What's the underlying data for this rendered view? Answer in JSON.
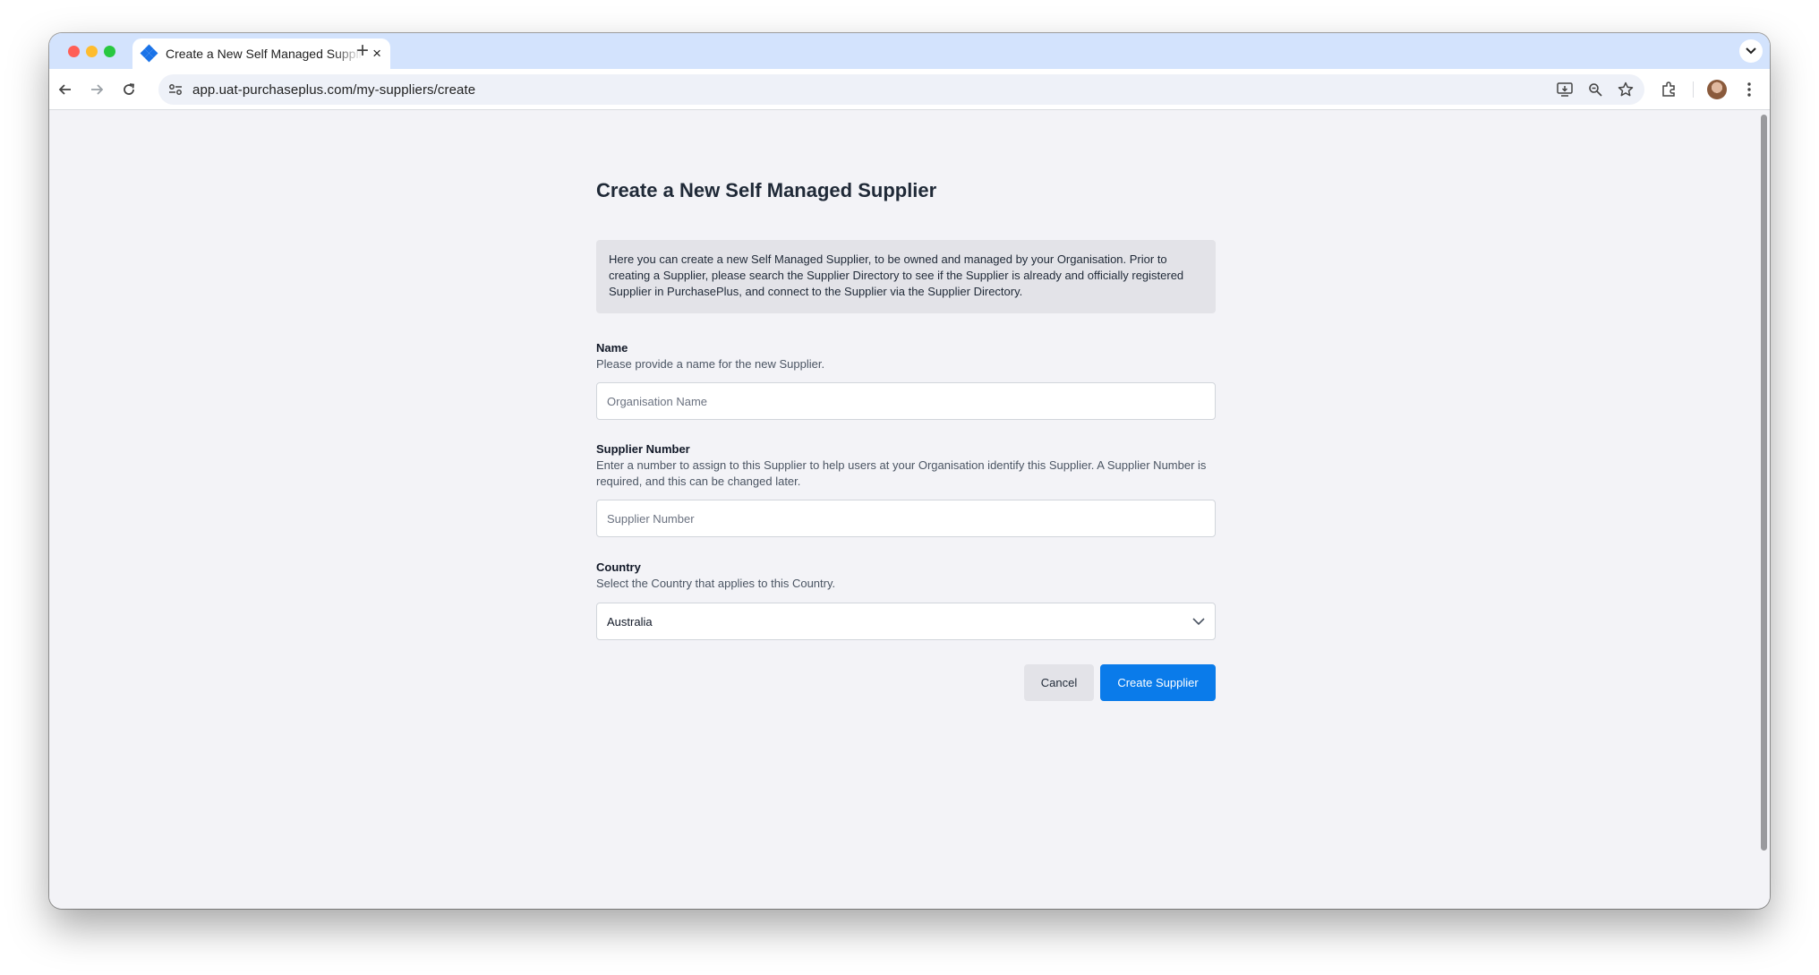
{
  "browser": {
    "tab_title": "Create a New Self Managed Supplier",
    "tab_close": "×",
    "new_tab": "+",
    "url": "app.uat-purchaseplus.com/my-suppliers/create"
  },
  "page": {
    "title": "Create a New Self Managed Supplier",
    "notice": "Here you can create a new Self Managed Supplier, to be owned and managed by your Organisation. Prior to creating a Supplier, please search the Supplier Directory to see if the Supplier is already and officially registered Supplier in PurchasePlus, and connect to the Supplier via the Supplier Directory."
  },
  "form": {
    "name": {
      "label": "Name",
      "help": "Please provide a name for the new Supplier.",
      "placeholder": "Organisation Name",
      "value": ""
    },
    "supplier_number": {
      "label": "Supplier Number",
      "help": "Enter a number to assign to this Supplier to help users at your Organisation identify this Supplier. A Supplier Number is required, and this can be changed later.",
      "placeholder": "Supplier Number",
      "value": ""
    },
    "country": {
      "label": "Country",
      "help": "Select the Country that applies to this Country.",
      "selected": "Australia"
    }
  },
  "actions": {
    "cancel_label": "Cancel",
    "submit_label": "Create Supplier"
  },
  "colors": {
    "primary": "#0a7bea",
    "page_bg": "#f3f3f7",
    "tabstrip": "#d3e3fd",
    "notice_bg": "#e3e3e8"
  },
  "icons": [
    "back-arrow-icon",
    "forward-arrow-icon",
    "reload-icon",
    "site-info-icon",
    "install-app-icon",
    "zoom-icon",
    "bookmark-star-icon",
    "extensions-icon",
    "kebab-menu-icon",
    "chevron-down-icon",
    "favicon-icon"
  ]
}
